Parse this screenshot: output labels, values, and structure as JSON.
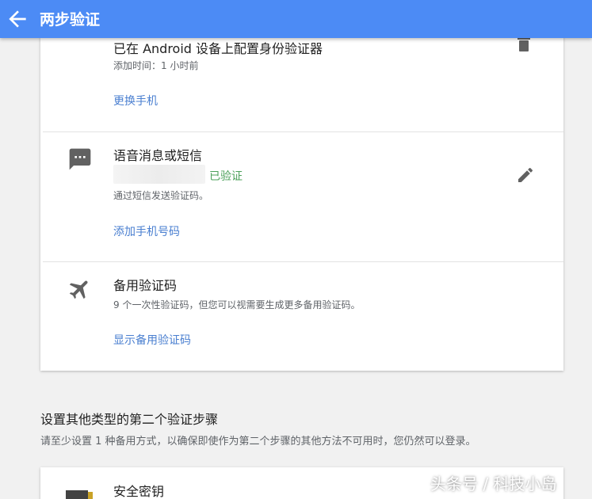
{
  "appbar": {
    "title": "两步验证",
    "back_icon": "arrow-back-icon"
  },
  "authenticator": {
    "heading": "已在 Android 设备上配置身份验证器",
    "added_time": "添加时间：1 小时前",
    "change_phone_link": "更换手机",
    "delete_icon": "trash-icon"
  },
  "voice_sms": {
    "heading": "语音消息或短信",
    "verified_label": "已验证",
    "description": "通过短信发送验证码。",
    "add_phone_link": "添加手机号码",
    "edit_icon": "pencil-icon",
    "icon": "message-icon"
  },
  "backup_codes": {
    "heading": "备用验证码",
    "description": "9 个一次性验证码，但您可以视需要生成更多备用验证码。",
    "show_link": "显示备用验证码",
    "icon": "airplane-icon"
  },
  "other_steps": {
    "title": "设置其他类型的第二个验证步骤",
    "description": "请至少设置 1 种备用方式，以确保即使作为第二个步骤的其他方法不可用时，您仍然可以登录。"
  },
  "security_key": {
    "heading": "安全密钥",
    "icon": "security-key-icon"
  },
  "watermark": "头条号 / 科技小岛",
  "colors": {
    "appbar": "#4c8bf5",
    "link": "#4a7fd0",
    "verified": "#4ca05a"
  }
}
